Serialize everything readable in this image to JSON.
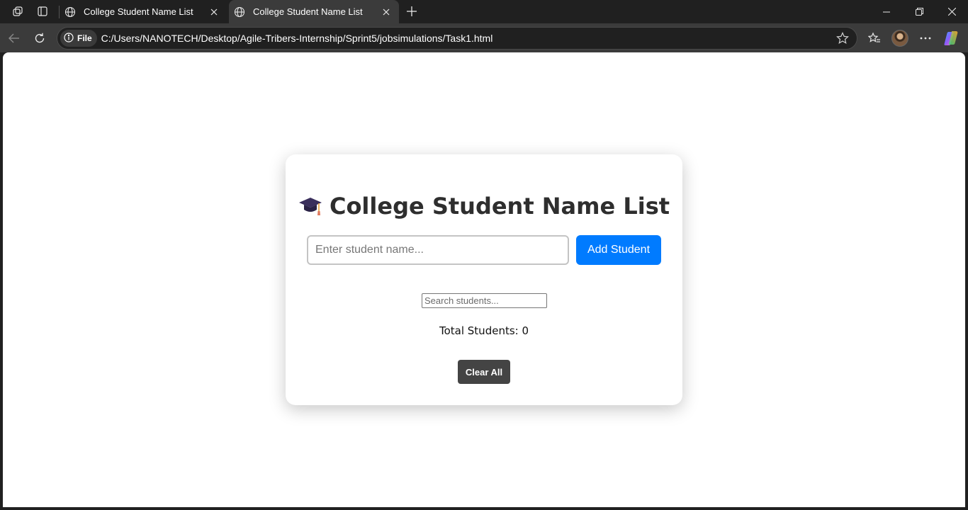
{
  "browser": {
    "tabs": [
      {
        "title": "College Student Name List",
        "active": false
      },
      {
        "title": "College Student Name List",
        "active": true
      }
    ],
    "address": {
      "scheme_label": "File",
      "url": "C:/Users/NANOTECH/Desktop/Agile-Tribers-Internship/Sprint5/jobsimulations/Task1.html"
    }
  },
  "app": {
    "title": "College Student Name List",
    "title_icon": "graduation-cap-icon",
    "name_input": {
      "placeholder": "Enter student name...",
      "value": ""
    },
    "add_button_label": "Add Student",
    "search_input": {
      "placeholder": "Search students...",
      "value": ""
    },
    "total_label": "Total Students: 0",
    "clear_button_label": "Clear All",
    "colors": {
      "add_button": "#007bff",
      "clear_button": "#444444",
      "title_text": "#2e2e2e"
    }
  }
}
